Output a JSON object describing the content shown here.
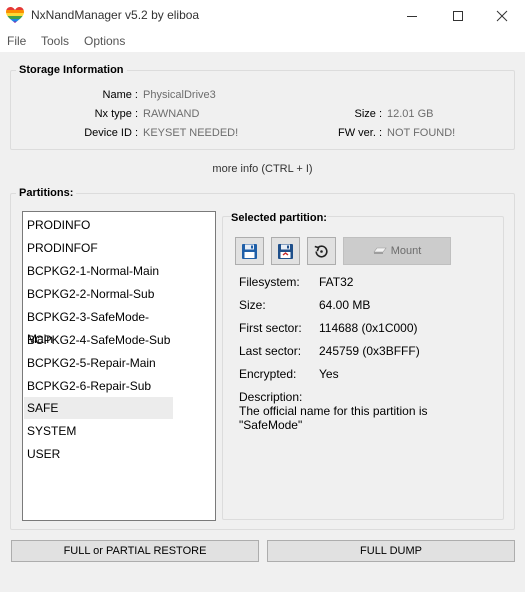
{
  "window": {
    "title": "NxNandManager v5.2 by eliboa",
    "icon": "rainbow-heart-icon"
  },
  "menu": {
    "items": [
      {
        "label": "File"
      },
      {
        "label": "Tools"
      },
      {
        "label": "Options"
      }
    ]
  },
  "storage": {
    "group_title": "Storage Information",
    "name_label": "Name :",
    "name_value": "PhysicalDrive3",
    "nxtype_label": "Nx type :",
    "nxtype_value": "RAWNAND",
    "deviceid_label": "Device ID :",
    "deviceid_value": "KEYSET NEEDED!",
    "size_label": "Size :",
    "size_value": "12.01 GB",
    "fwver_label": "FW ver. :",
    "fwver_value": "NOT FOUND!",
    "more_info": "more info (CTRL + I)"
  },
  "partitions": {
    "group_title": "Partitions:",
    "items": [
      "PRODINFO",
      "PRODINFOF",
      "BCPKG2-1-Normal-Main",
      "BCPKG2-2-Normal-Sub",
      "BCPKG2-3-SafeMode-Main",
      "BCPKG2-4-SafeMode-Sub",
      "BCPKG2-5-Repair-Main",
      "BCPKG2-6-Repair-Sub",
      "SAFE",
      "SYSTEM",
      "USER"
    ],
    "selected": "SAFE"
  },
  "selected_partition": {
    "title": "Selected partition:",
    "mount_label": "Mount",
    "filesystem_label": "Filesystem:",
    "filesystem_value": "FAT32",
    "size_label": "Size:",
    "size_value": "64.00 MB",
    "first_sector_label": "First sector:",
    "first_sector_value": "114688 (0x1C000)",
    "last_sector_label": "Last sector:",
    "last_sector_value": "245759 (0x3BFFF)",
    "encrypted_label": "Encrypted:",
    "encrypted_value": "Yes",
    "description_label": "Description:",
    "description_value": "The official name for this partition is \"SafeMode\""
  },
  "actions": {
    "restore_label": "FULL or PARTIAL RESTORE",
    "dump_label": "FULL DUMP"
  }
}
